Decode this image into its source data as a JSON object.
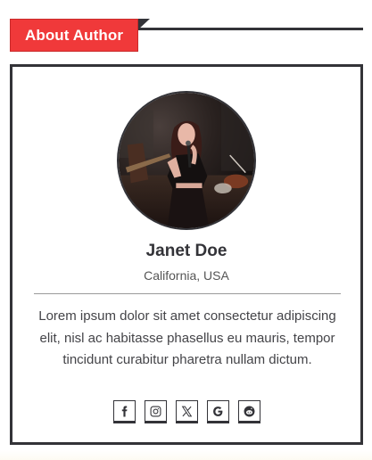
{
  "header": {
    "title": "About Author"
  },
  "author": {
    "name": "Janet Doe",
    "location": "California, USA",
    "bio": "Lorem ipsum dolor sit amet consectetur adipiscing elit, nisl ac habitasse phasellus eu mauris, tempor tincidunt curabitur pharetra nullam dictum."
  },
  "socials": [
    {
      "icon": "facebook-icon"
    },
    {
      "icon": "instagram-icon"
    },
    {
      "icon": "x-twitter-icon"
    },
    {
      "icon": "google-icon"
    },
    {
      "icon": "reddit-icon"
    }
  ],
  "colors": {
    "accent": "#f0393a",
    "dark": "#333338",
    "text": "#444448"
  }
}
